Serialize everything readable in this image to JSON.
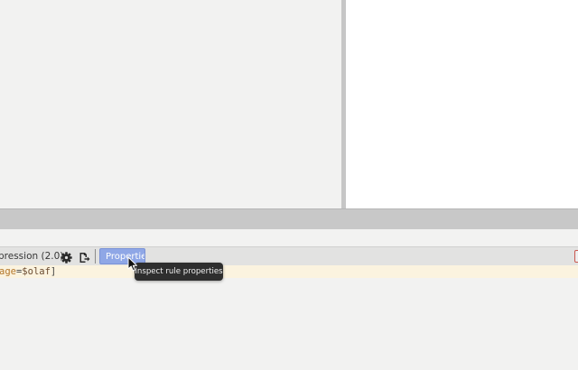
{
  "toolbar": {
    "expression_label": "pression (2.0)",
    "gear_icon": "gear-icon",
    "export_icon": "export-icon",
    "properties_label": "Properties"
  },
  "expression": {
    "attr": "age",
    "op": "=",
    "var": "$olaf",
    "bracket": "]"
  },
  "tooltip": {
    "text": "Inspect rule properties"
  },
  "colors": {
    "properties_button_bg": "#8fa7e6",
    "tooltip_bg": "#2e2e2e",
    "expression_bg": "#fbf3df",
    "splitter": "#c8c8c8"
  }
}
